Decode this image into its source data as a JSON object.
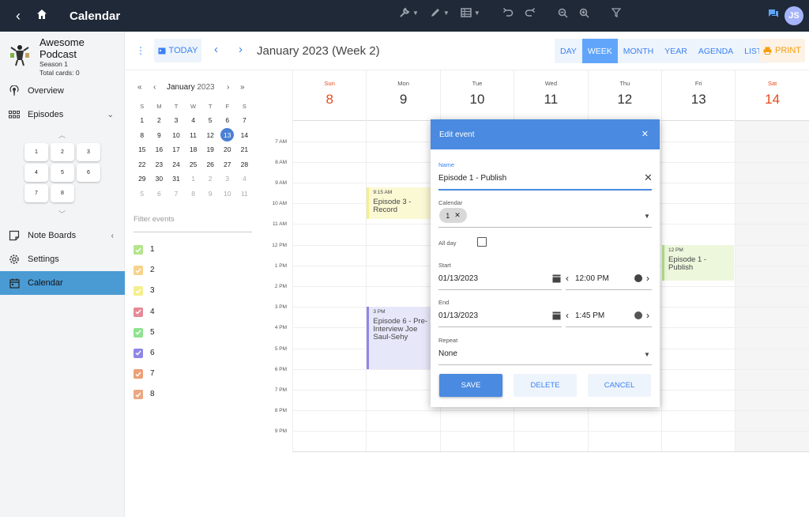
{
  "topbar": {
    "title": "Calendar",
    "back_icon": "back-arrow",
    "user_initials": "JS"
  },
  "sidebar": {
    "podcast_name": "Awesome Podcast",
    "podcast_season": "Season 1",
    "podcast_cards": "Total cards: 0",
    "nav": {
      "overview": "Overview",
      "episodes": "Episodes",
      "note_boards": "Note Boards",
      "settings": "Settings",
      "calendar": "Calendar"
    },
    "episodes": [
      "1",
      "2",
      "3",
      "4",
      "5",
      "6",
      "7",
      "8"
    ]
  },
  "toolbar": {
    "today": "TODAY",
    "title": "January 2023 (Week 2)",
    "views": [
      "DAY",
      "WEEK",
      "MONTH",
      "YEAR",
      "AGENDA",
      "LIST"
    ],
    "active_view": "WEEK",
    "print": "PRINT"
  },
  "mini_calendar": {
    "month": "January",
    "year": "2023",
    "weekdays": [
      "S",
      "M",
      "T",
      "W",
      "T",
      "F",
      "S"
    ],
    "weeks": [
      [
        "1",
        "2",
        "3",
        "4",
        "5",
        "6",
        "7"
      ],
      [
        "8",
        "9",
        "10",
        "11",
        "12",
        "13",
        "14"
      ],
      [
        "15",
        "16",
        "17",
        "18",
        "19",
        "20",
        "21"
      ],
      [
        "22",
        "23",
        "24",
        "25",
        "26",
        "27",
        "28"
      ],
      [
        "29",
        "30",
        "31",
        "1",
        "2",
        "3",
        "4"
      ],
      [
        "5",
        "6",
        "7",
        "8",
        "9",
        "10",
        "11"
      ]
    ],
    "selected": "13"
  },
  "filter_placeholder": "Filter events",
  "calendars": [
    {
      "label": "1",
      "color": "#b5e48c"
    },
    {
      "label": "2",
      "color": "#f6d38a"
    },
    {
      "label": "3",
      "color": "#f5ee8e"
    },
    {
      "label": "4",
      "color": "#e58a96"
    },
    {
      "label": "5",
      "color": "#8fe38f"
    },
    {
      "label": "6",
      "color": "#8e86e8"
    },
    {
      "label": "7",
      "color": "#ec9f78"
    },
    {
      "label": "8",
      "color": "#eaa882"
    }
  ],
  "week": {
    "days": [
      {
        "name": "Sun",
        "date": "8"
      },
      {
        "name": "Mon",
        "date": "9"
      },
      {
        "name": "Tue",
        "date": "10"
      },
      {
        "name": "Wed",
        "date": "11"
      },
      {
        "name": "Thu",
        "date": "12"
      },
      {
        "name": "Fri",
        "date": "13"
      },
      {
        "name": "Sat",
        "date": "14"
      }
    ],
    "hours": [
      "7 AM",
      "8 AM",
      "9 AM",
      "10 AM",
      "11 AM",
      "12 PM",
      "1 PM",
      "2 PM",
      "3 PM",
      "4 PM",
      "5 PM",
      "6 PM",
      "7 PM",
      "8 PM",
      "9 PM"
    ],
    "events": [
      {
        "time": "9:15 AM",
        "title": "Episode 3 - Record",
        "day": 1,
        "start": 9.25,
        "end": 10.75,
        "bg": "#fbf9d4",
        "border": "#f5ee8e"
      },
      {
        "time": "3 PM",
        "title": "Episode 6 - Pre-Interview Joe Saul-Sehy",
        "day": 1,
        "start": 15,
        "end": 18,
        "bg": "#e7e7fa",
        "border": "#8e86e8"
      },
      {
        "time": "12 PM",
        "title": "Episode 1 - Publish",
        "day": 5,
        "start": 12,
        "end": 13.75,
        "bg": "#ecf7dc",
        "border": "#b5e48c"
      }
    ]
  },
  "dialog": {
    "title": "Edit event",
    "name_label": "Name",
    "name_value": "Episode 1 - Publish",
    "calendar_label": "Calendar",
    "calendar_chip": "1",
    "allday_label": "All day",
    "start_label": "Start",
    "start_date": "01/13/2023",
    "start_time": "12:00 PM",
    "end_label": "End",
    "end_date": "01/13/2023",
    "end_time": "1:45 PM",
    "repeat_label": "Repeat",
    "repeat_value": "None",
    "save": "SAVE",
    "delete": "DELETE",
    "cancel": "CANCEL"
  }
}
